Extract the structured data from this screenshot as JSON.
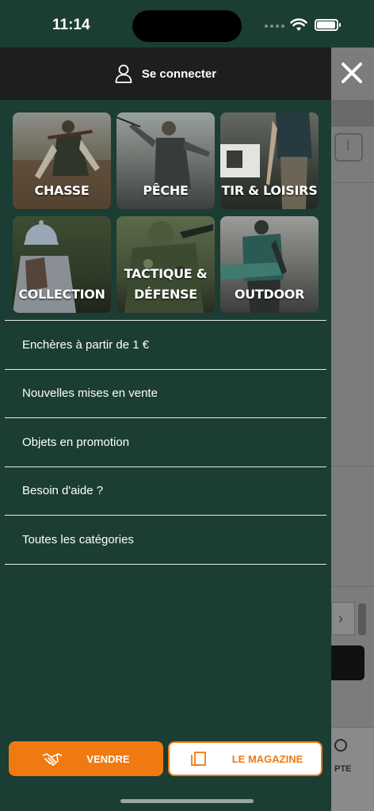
{
  "status_bar": {
    "time": "11:14"
  },
  "drawer": {
    "login_label": "Se connecter",
    "categories": [
      {
        "label": "CHASSE"
      },
      {
        "label": "PÊCHE"
      },
      {
        "label": "TIR & LOISIRS"
      },
      {
        "label": "COLLECTION"
      },
      {
        "label": "TACTIQUE &\nDÉFENSE"
      },
      {
        "label": "OUTDOOR"
      }
    ],
    "menu": [
      {
        "label": "Enchères à partir de 1 €"
      },
      {
        "label": "Nouvelles mises en vente"
      },
      {
        "label": "Objets en promotion"
      },
      {
        "label": "Besoin d'aide ?"
      },
      {
        "label": "Toutes les catégories"
      }
    ],
    "actions": {
      "sell_label": "VENDRE",
      "magazine_label": "LE MAGAZINE"
    }
  },
  "background_page": {
    "tab_label_partial": "PTE"
  },
  "colors": {
    "drawer_bg": "#1b3d33",
    "accent": "#f07a12",
    "login_bar": "#1c1f1e"
  }
}
